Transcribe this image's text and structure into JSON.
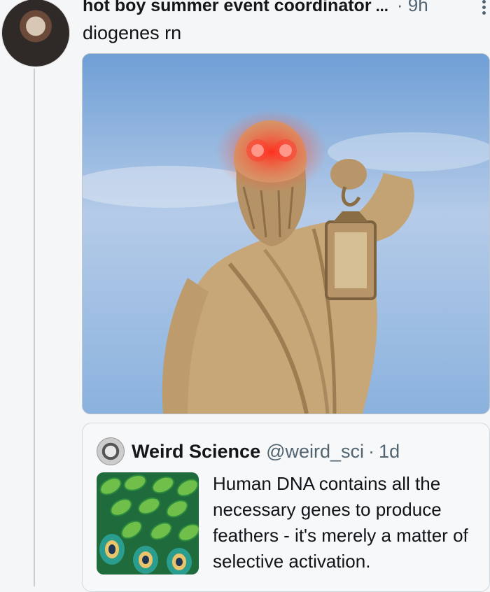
{
  "tweet": {
    "author_name": "hot boy summer event coordinator",
    "truncation": "...",
    "time": "· 9h",
    "text": "diogenes rn",
    "more_icon": "more-vertical-icon"
  },
  "quote": {
    "name": "Weird Science",
    "handle": "@weird_sci",
    "separator": "·",
    "time": "1d",
    "text": "Human DNA contains all the necessary genes to produce feathers - it's merely a matter of selective activation."
  },
  "colors": {
    "sky": "#8fb4df",
    "statue": "#c9a878",
    "laser_eyes": "#ff3b2f"
  }
}
